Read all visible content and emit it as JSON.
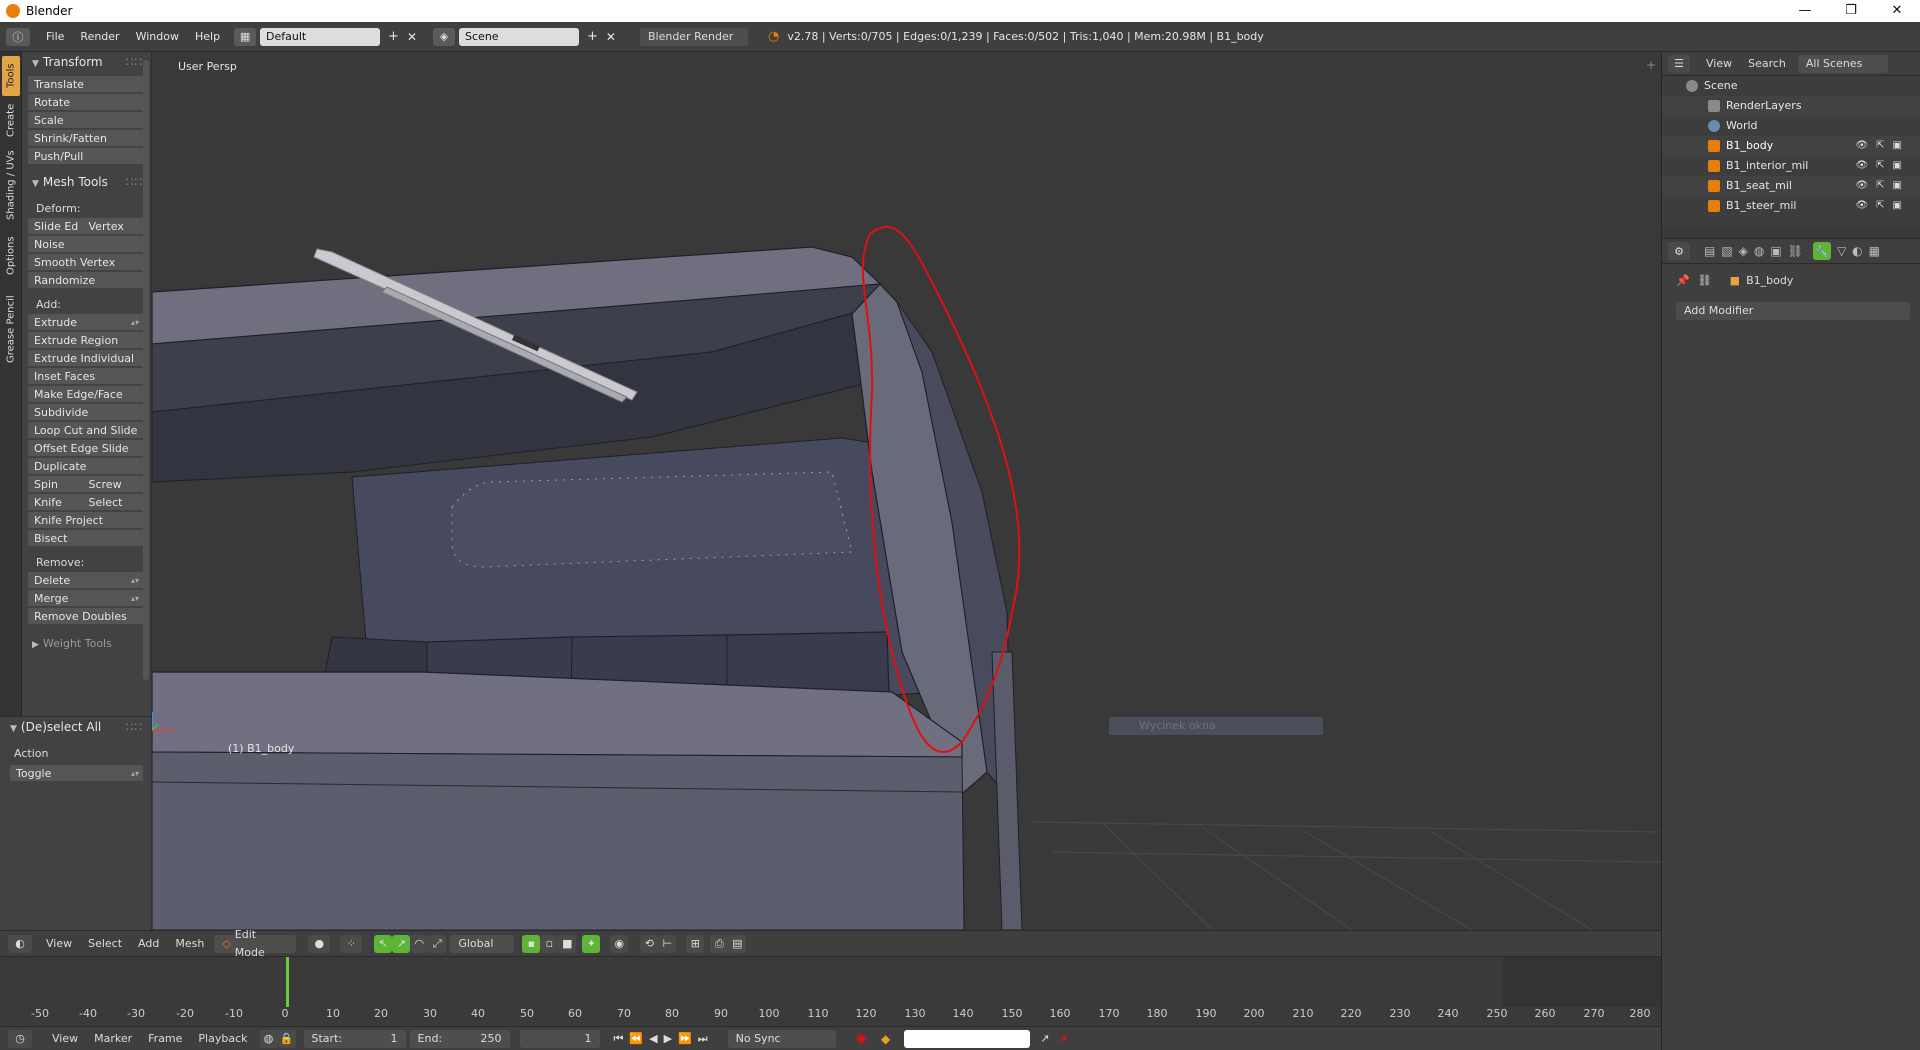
{
  "window": {
    "title": "Blender",
    "controls": {
      "minimize": "—",
      "maximize": "❐",
      "close": "✕"
    }
  },
  "info_header": {
    "menus": [
      "File",
      "Render",
      "Window",
      "Help"
    ],
    "screen_layout": "Default",
    "scene": "Scene",
    "render_engine": "Blender Render",
    "stats": "v2.78 | Verts:0/705 | Edges:0/1,239 | Faces:0/502 | Tris:1,040 | Mem:20.98M | B1_body"
  },
  "tool_tabs": [
    "Tools",
    "Create",
    "Shading / UVs",
    "Options",
    "Grease Pencil"
  ],
  "toolshelf": {
    "transform": {
      "title": "Transform",
      "buttons": [
        "Translate",
        "Rotate",
        "Scale",
        "Shrink/Fatten",
        "Push/Pull"
      ]
    },
    "mesh_tools": {
      "title": "Mesh Tools",
      "deform_label": "Deform:",
      "deform": {
        "slide_edge": "Slide Ed",
        "vertex": "Vertex",
        "noise": "Noise",
        "smooth": "Smooth Vertex",
        "randomize": "Randomize"
      },
      "add_label": "Add:",
      "add": {
        "extrude": "Extrude",
        "extrude_region": "Extrude Region",
        "extrude_individual": "Extrude Individual",
        "inset": "Inset Faces",
        "make_edge": "Make Edge/Face",
        "subdivide": "Subdivide",
        "loop_cut": "Loop Cut and Slide",
        "offset_edge": "Offset Edge Slide",
        "duplicate": "Duplicate",
        "spin": "Spin",
        "screw": "Screw",
        "knife": "Knife",
        "select": "Select",
        "knife_project": "Knife Project",
        "bisect": "Bisect"
      },
      "remove_label": "Remove:",
      "remove": {
        "delete": "Delete",
        "merge": "Merge",
        "remove_doubles": "Remove Doubles"
      }
    },
    "weight_tools": "Weight Tools"
  },
  "operator_panel": {
    "title": "(De)select All",
    "action_label": "Action",
    "action_value": "Toggle"
  },
  "viewport": {
    "view_name": "User Persp",
    "object_label": "(1) B1_body",
    "ghost_text": "Wycinek okna"
  },
  "view3d_header": {
    "menus": [
      "View",
      "Select",
      "Add",
      "Mesh"
    ],
    "mode": "Edit Mode",
    "orientation": "Global"
  },
  "timeline": {
    "ruler": [
      "-50",
      "-40",
      "-30",
      "-20",
      "-10",
      "0",
      "10",
      "20",
      "30",
      "40",
      "50",
      "60",
      "70",
      "80",
      "90",
      "100",
      "110",
      "120",
      "130",
      "140",
      "150",
      "160",
      "170",
      "180",
      "190",
      "200",
      "210",
      "220",
      "230",
      "240",
      "250",
      "260",
      "270",
      "280"
    ],
    "current_frame": "1",
    "menus": [
      "View",
      "Marker",
      "Frame",
      "Playback"
    ],
    "start_label": "Start:",
    "start_value": "1",
    "end_label": "End:",
    "end_value": "250",
    "frame_value": "1",
    "sync": "No Sync"
  },
  "outliner": {
    "menus": [
      "View",
      "Search"
    ],
    "filter": "All Scenes",
    "rows": [
      {
        "label": "Scene",
        "indent": 0
      },
      {
        "label": "RenderLayers",
        "indent": 1
      },
      {
        "label": "World",
        "indent": 1
      },
      {
        "label": "B1_body",
        "indent": 1
      },
      {
        "label": "B1_interior_mil",
        "indent": 1
      },
      {
        "label": "B1_seat_mil",
        "indent": 1
      },
      {
        "label": "B1_steer_mil",
        "indent": 1
      }
    ]
  },
  "properties": {
    "object_name": "B1_body",
    "add_modifier": "Add Modifier"
  },
  "colors": {
    "accent_orange": "#e87d0d",
    "active_green": "#5eb434",
    "annotation_red": "#e01010",
    "frame_green": "#6acc3a"
  }
}
